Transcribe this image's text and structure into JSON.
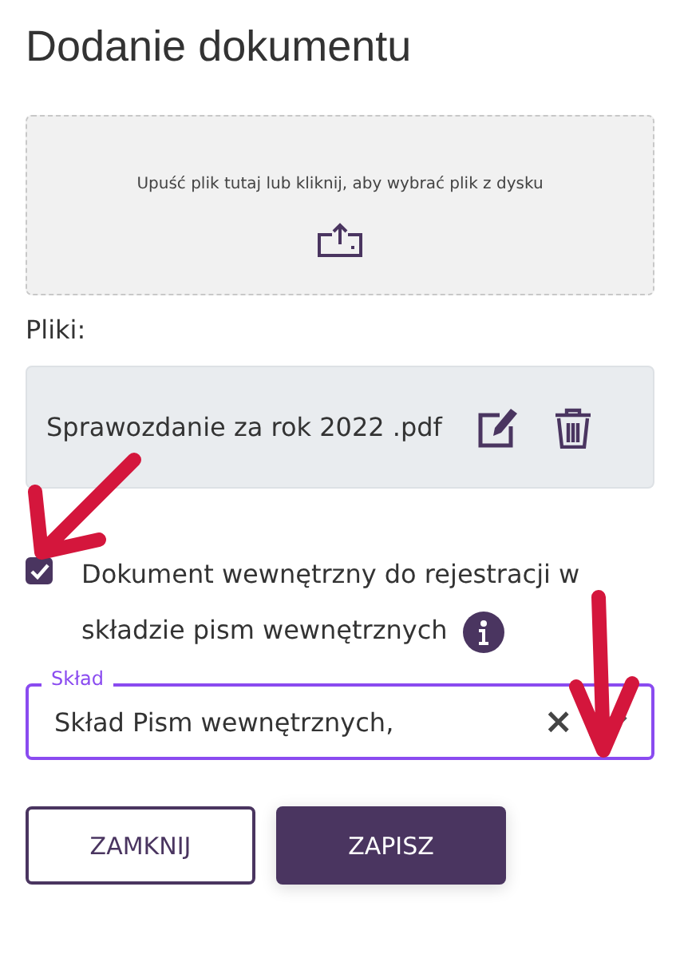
{
  "title": "Dodanie dokumentu",
  "dropzone": {
    "text": "Upuść plik tutaj lub kliknij, aby wybrać plik z dysku"
  },
  "files_label": "Pliki:",
  "files": [
    {
      "name": "Sprawozdanie za rok 2022 .pdf"
    }
  ],
  "checkbox": {
    "label": "Dokument wewnętrzny do rejestracji w składzie pism wewnętrznych",
    "checked": true
  },
  "select": {
    "label": "Skład",
    "value": "Skład Pism wewnętrznych,",
    "clear": "×"
  },
  "buttons": [
    {
      "label": "ZAMKNIJ",
      "kind": "secondary"
    },
    {
      "label": "ZAPISZ",
      "kind": "primary"
    }
  ]
}
